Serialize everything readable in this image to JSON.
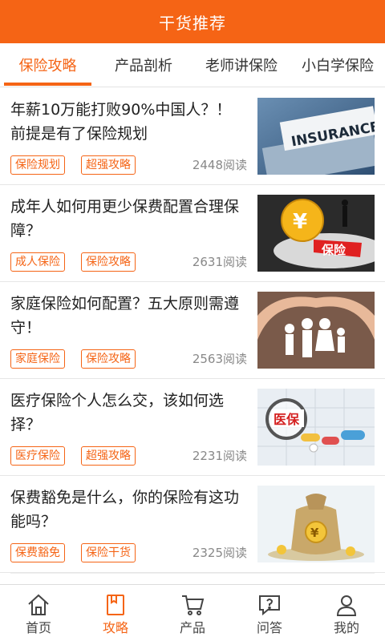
{
  "header": {
    "title": "干货推荐"
  },
  "tabs": [
    {
      "label": "保险攻略",
      "active": true
    },
    {
      "label": "产品剖析",
      "active": false
    },
    {
      "label": "老师讲保险",
      "active": false
    },
    {
      "label": "小白学保险",
      "active": false
    }
  ],
  "articles": [
    {
      "title": "年薪10万能打败90%中国人？！前提是有了保险规划",
      "tags": [
        "保险规划",
        "超强攻略"
      ],
      "reads": "2448阅读",
      "thumb_text": "INSURANCE"
    },
    {
      "title": "成年人如何用更少保费配置合理保障？",
      "tags": [
        "成人保险",
        "保险攻略"
      ],
      "reads": "2631阅读",
      "thumb_text": "保险",
      "thumb_symbol": "¥"
    },
    {
      "title": "家庭保险如何配置？五大原则需遵守！",
      "tags": [
        "家庭保险",
        "保险攻略"
      ],
      "reads": "2563阅读"
    },
    {
      "title": "医疗保险个人怎么交，该如何选择？",
      "tags": [
        "医疗保险",
        "超强攻略"
      ],
      "reads": "2231阅读",
      "thumb_text": "医保"
    },
    {
      "title": "保费豁免是什么，你的保险有这功能吗？",
      "tags": [
        "保费豁免",
        "保险干货"
      ],
      "reads": "2325阅读",
      "thumb_symbol": "¥"
    }
  ],
  "bottom_nav": [
    {
      "label": "首页",
      "icon": "home-icon",
      "active": false
    },
    {
      "label": "攻略",
      "icon": "book-icon",
      "active": true
    },
    {
      "label": "产品",
      "icon": "cart-icon",
      "active": false
    },
    {
      "label": "问答",
      "icon": "chat-question-icon",
      "active": false
    },
    {
      "label": "我的",
      "icon": "user-icon",
      "active": false
    }
  ],
  "colors": {
    "accent": "#f56415",
    "text": "#222222",
    "muted": "#888888"
  }
}
